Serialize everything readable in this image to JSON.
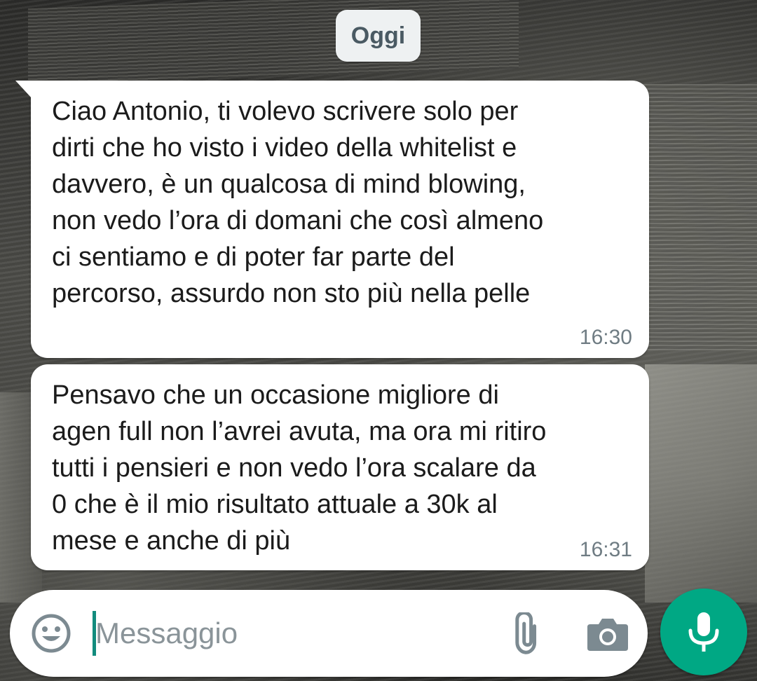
{
  "date_chip": "Oggi",
  "messages": [
    {
      "text": "Ciao Antonio, ti volevo scrivere solo per\ndirti che ho visto i video della whitelist e\ndavvero, è un qualcosa di mind blowing,\nnon vedo l’ora di domani che così almeno\nci sentiamo e di poter far parte del\npercorso, assurdo non sto più nella pelle",
      "time": "16:30"
    },
    {
      "text": "Pensavo che un occasione migliore di\nagen full non l’avrei avuta, ma ora mi ritiro\ntutti i pensieri e non vedo l’ora scalare da\n0 che è il mio risultato attuale a 30k al\nmese e anche di più",
      "time": "16:31"
    }
  ],
  "composer": {
    "placeholder": "Messaggio",
    "value": "",
    "icons": [
      "emoji-icon",
      "attach-icon",
      "camera-icon",
      "mic-icon"
    ]
  },
  "colors": {
    "accent": "#00a884",
    "bubble": "#ffffff",
    "timestamp": "#6f7c83",
    "date_chip_bg": "#eef1f2"
  }
}
